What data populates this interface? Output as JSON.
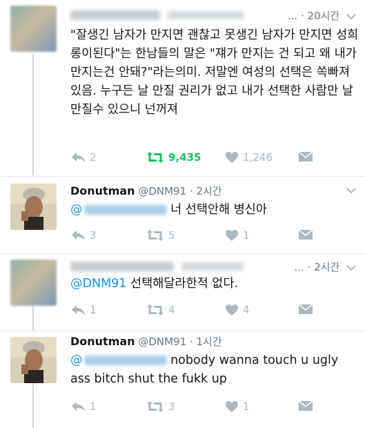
{
  "tweets": [
    {
      "time": "20시간",
      "text": "\"잘생긴 남자가 만지면 괜찮고 못생긴 남자가 만지면 성희롱이된다\"는 한남들의 말은 \"쟤가 만지는 건 되고 왜 내가 만지는건 안돼?\"라는의미. 저말엔 여성의 선택은 쏙빠져있음. 누구든 날 만질 권리가 없고 내가 선택한 사람만 날만질수 있으니 넌꺼져",
      "replies": "2",
      "retweets": "9,435",
      "likes": "1,246"
    },
    {
      "name": "Donutman",
      "handle": "@DNM91",
      "time": "2시간",
      "mention": "@",
      "text": "너 선택안해 병신아",
      "replies": "3",
      "retweets": "5",
      "likes": "1"
    },
    {
      "time": "2시간",
      "mention": "@DNM91",
      "text": "선택해달라한적 없다.",
      "replies": "1",
      "retweets": "4",
      "likes": "4"
    },
    {
      "name": "Donutman",
      "handle": "@DNM91",
      "time": "1시간",
      "mention": "@",
      "text": "nobody wanna touch u ugly ass bitch shut the fukk up",
      "replies": "1",
      "retweets": "3",
      "likes": "1"
    }
  ],
  "ui": {
    "sep": "·",
    "ellipsis": "..."
  },
  "colors": {
    "mention": "#1b95e0",
    "retweet_active": "#17bf63",
    "muted": "#aab8c2",
    "meta": "#657786"
  }
}
